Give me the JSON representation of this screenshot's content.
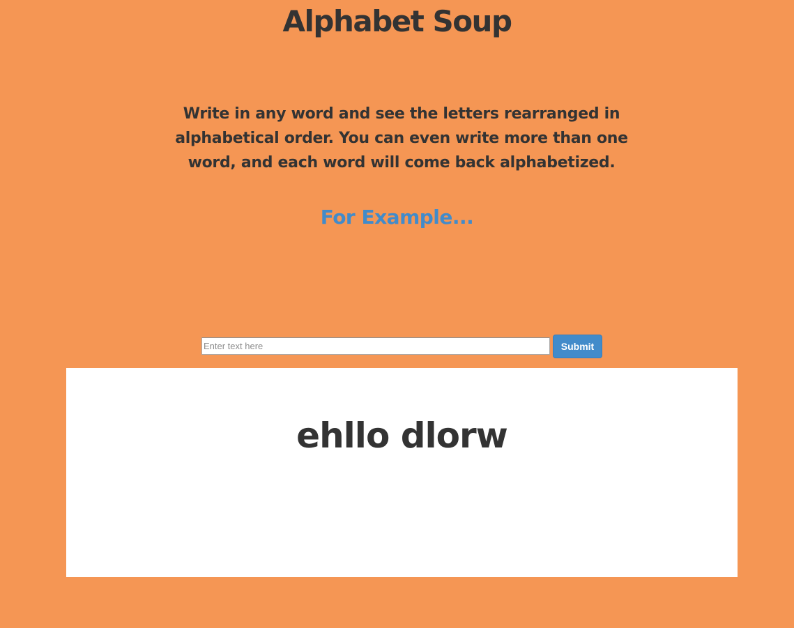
{
  "header": {
    "title": "Alphabet Soup"
  },
  "intro": {
    "description": "Write in any word and see the letters rearranged in alphabetical order. You can even write more than one word, and each word will come back alphabetized.",
    "example_heading": "For Example..."
  },
  "form": {
    "input_value": "",
    "input_placeholder": "Enter text here",
    "submit_label": "Submit"
  },
  "result": {
    "text": "ehllo dlorw"
  },
  "colors": {
    "background": "#F59654",
    "text": "#333333",
    "accent": "#428BCA",
    "panel": "#FFFFFF"
  }
}
